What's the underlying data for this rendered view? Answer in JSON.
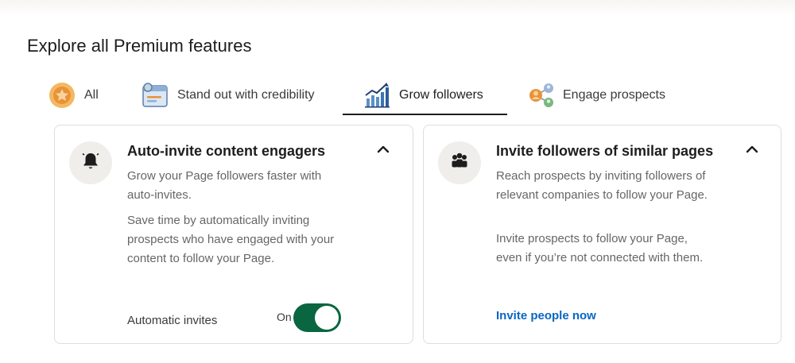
{
  "page": {
    "title": "Explore all Premium features"
  },
  "tabs": [
    {
      "label": "All",
      "icon": "star-badge-icon",
      "active": false
    },
    {
      "label": "Stand out with credibility",
      "icon": "profile-card-icon",
      "active": false
    },
    {
      "label": "Grow followers",
      "icon": "growth-chart-icon",
      "active": true
    },
    {
      "label": "Engage prospects",
      "icon": "people-network-icon",
      "active": false
    }
  ],
  "cards": [
    {
      "icon": "bell-icon",
      "title": "Auto-invite content engagers",
      "paragraphs": [
        "Grow your Page followers faster with auto-invites.",
        "Save time by automatically inviting prospects who have engaged with your content to follow your Page."
      ],
      "toggle": {
        "label": "Automatic invites",
        "state_text": "On",
        "on": true
      }
    },
    {
      "icon": "people-group-icon",
      "title": "Invite followers of similar pages",
      "paragraphs": [
        "Reach prospects by inviting followers of relevant companies to follow your Page.",
        "Invite prospects to follow your Page, even if you’re not connected with them."
      ],
      "link": "Invite people now"
    }
  ],
  "colors": {
    "toggle_on": "#0a6640",
    "link": "#0a66c2",
    "icon_circle": "#efeeea"
  }
}
